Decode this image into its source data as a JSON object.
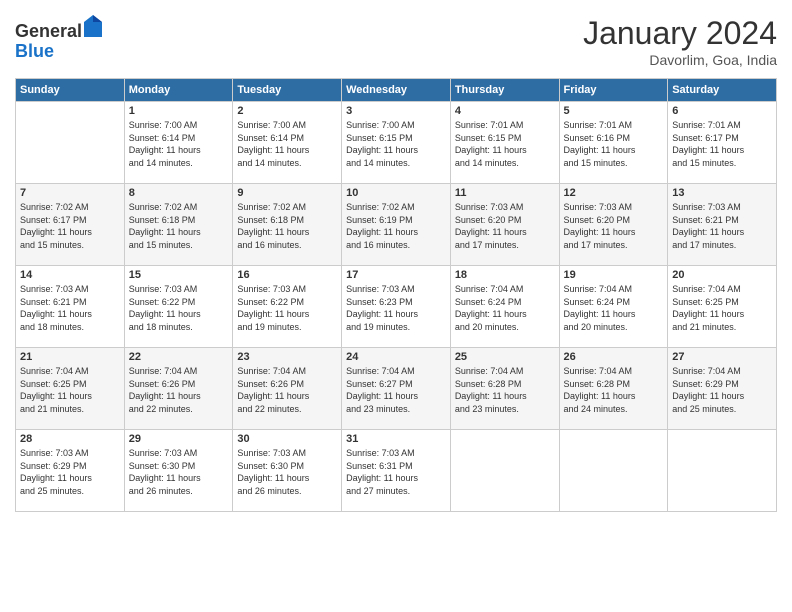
{
  "header": {
    "logo_general": "General",
    "logo_blue": "Blue",
    "month_title": "January 2024",
    "location": "Davorlim, Goa, India"
  },
  "days_of_week": [
    "Sunday",
    "Monday",
    "Tuesday",
    "Wednesday",
    "Thursday",
    "Friday",
    "Saturday"
  ],
  "weeks": [
    [
      {
        "num": "",
        "info": ""
      },
      {
        "num": "1",
        "info": "Sunrise: 7:00 AM\nSunset: 6:14 PM\nDaylight: 11 hours\nand 14 minutes."
      },
      {
        "num": "2",
        "info": "Sunrise: 7:00 AM\nSunset: 6:14 PM\nDaylight: 11 hours\nand 14 minutes."
      },
      {
        "num": "3",
        "info": "Sunrise: 7:00 AM\nSunset: 6:15 PM\nDaylight: 11 hours\nand 14 minutes."
      },
      {
        "num": "4",
        "info": "Sunrise: 7:01 AM\nSunset: 6:15 PM\nDaylight: 11 hours\nand 14 minutes."
      },
      {
        "num": "5",
        "info": "Sunrise: 7:01 AM\nSunset: 6:16 PM\nDaylight: 11 hours\nand 15 minutes."
      },
      {
        "num": "6",
        "info": "Sunrise: 7:01 AM\nSunset: 6:17 PM\nDaylight: 11 hours\nand 15 minutes."
      }
    ],
    [
      {
        "num": "7",
        "info": "Sunrise: 7:02 AM\nSunset: 6:17 PM\nDaylight: 11 hours\nand 15 minutes."
      },
      {
        "num": "8",
        "info": "Sunrise: 7:02 AM\nSunset: 6:18 PM\nDaylight: 11 hours\nand 15 minutes."
      },
      {
        "num": "9",
        "info": "Sunrise: 7:02 AM\nSunset: 6:18 PM\nDaylight: 11 hours\nand 16 minutes."
      },
      {
        "num": "10",
        "info": "Sunrise: 7:02 AM\nSunset: 6:19 PM\nDaylight: 11 hours\nand 16 minutes."
      },
      {
        "num": "11",
        "info": "Sunrise: 7:03 AM\nSunset: 6:20 PM\nDaylight: 11 hours\nand 17 minutes."
      },
      {
        "num": "12",
        "info": "Sunrise: 7:03 AM\nSunset: 6:20 PM\nDaylight: 11 hours\nand 17 minutes."
      },
      {
        "num": "13",
        "info": "Sunrise: 7:03 AM\nSunset: 6:21 PM\nDaylight: 11 hours\nand 17 minutes."
      }
    ],
    [
      {
        "num": "14",
        "info": "Sunrise: 7:03 AM\nSunset: 6:21 PM\nDaylight: 11 hours\nand 18 minutes."
      },
      {
        "num": "15",
        "info": "Sunrise: 7:03 AM\nSunset: 6:22 PM\nDaylight: 11 hours\nand 18 minutes."
      },
      {
        "num": "16",
        "info": "Sunrise: 7:03 AM\nSunset: 6:22 PM\nDaylight: 11 hours\nand 19 minutes."
      },
      {
        "num": "17",
        "info": "Sunrise: 7:03 AM\nSunset: 6:23 PM\nDaylight: 11 hours\nand 19 minutes."
      },
      {
        "num": "18",
        "info": "Sunrise: 7:04 AM\nSunset: 6:24 PM\nDaylight: 11 hours\nand 20 minutes."
      },
      {
        "num": "19",
        "info": "Sunrise: 7:04 AM\nSunset: 6:24 PM\nDaylight: 11 hours\nand 20 minutes."
      },
      {
        "num": "20",
        "info": "Sunrise: 7:04 AM\nSunset: 6:25 PM\nDaylight: 11 hours\nand 21 minutes."
      }
    ],
    [
      {
        "num": "21",
        "info": "Sunrise: 7:04 AM\nSunset: 6:25 PM\nDaylight: 11 hours\nand 21 minutes."
      },
      {
        "num": "22",
        "info": "Sunrise: 7:04 AM\nSunset: 6:26 PM\nDaylight: 11 hours\nand 22 minutes."
      },
      {
        "num": "23",
        "info": "Sunrise: 7:04 AM\nSunset: 6:26 PM\nDaylight: 11 hours\nand 22 minutes."
      },
      {
        "num": "24",
        "info": "Sunrise: 7:04 AM\nSunset: 6:27 PM\nDaylight: 11 hours\nand 23 minutes."
      },
      {
        "num": "25",
        "info": "Sunrise: 7:04 AM\nSunset: 6:28 PM\nDaylight: 11 hours\nand 23 minutes."
      },
      {
        "num": "26",
        "info": "Sunrise: 7:04 AM\nSunset: 6:28 PM\nDaylight: 11 hours\nand 24 minutes."
      },
      {
        "num": "27",
        "info": "Sunrise: 7:04 AM\nSunset: 6:29 PM\nDaylight: 11 hours\nand 25 minutes."
      }
    ],
    [
      {
        "num": "28",
        "info": "Sunrise: 7:03 AM\nSunset: 6:29 PM\nDaylight: 11 hours\nand 25 minutes."
      },
      {
        "num": "29",
        "info": "Sunrise: 7:03 AM\nSunset: 6:30 PM\nDaylight: 11 hours\nand 26 minutes."
      },
      {
        "num": "30",
        "info": "Sunrise: 7:03 AM\nSunset: 6:30 PM\nDaylight: 11 hours\nand 26 minutes."
      },
      {
        "num": "31",
        "info": "Sunrise: 7:03 AM\nSunset: 6:31 PM\nDaylight: 11 hours\nand 27 minutes."
      },
      {
        "num": "",
        "info": ""
      },
      {
        "num": "",
        "info": ""
      },
      {
        "num": "",
        "info": ""
      }
    ]
  ]
}
